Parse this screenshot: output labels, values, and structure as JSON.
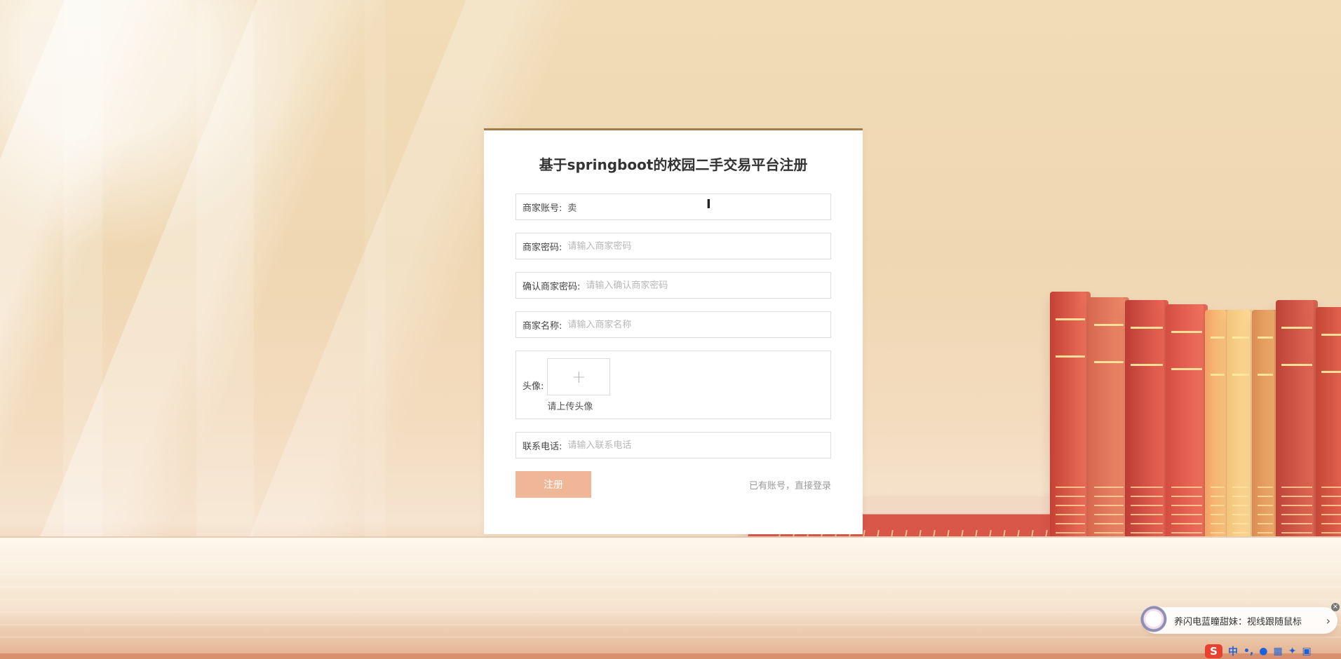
{
  "app": {
    "title": "基于springboot的校园二手交易平台注册"
  },
  "form": {
    "account_label": "商家账号:",
    "account_value": "卖",
    "account_placeholder": "",
    "password_label": "商家密码:",
    "password_placeholder": "请输入商家密码",
    "confirm_password_label": "确认商家密码:",
    "confirm_password_placeholder": "请输入确认商家密码",
    "merchant_name_label": "商家名称:",
    "merchant_name_placeholder": "请输入商家名称",
    "avatar_label": "头像:",
    "upload_icon": "+",
    "upload_hint": "请上传头像",
    "phone_label": "联系电话:",
    "phone_placeholder": "请输入联系电话",
    "register_button": "注册",
    "login_link": "已有账号，直接登录"
  },
  "popup": {
    "text": "养闪电蓝瞳甜妹：视线跟随鼠标",
    "arrow": "›",
    "close": "×"
  },
  "taskbar": {
    "sogou_icon": "S",
    "chinese_mode": "中",
    "symbol_mode": "•,",
    "mic_icon": "mic-icon",
    "keyboard_icon": "keyboard-icon",
    "skin_icon": "skin-icon",
    "grid_icon": "grid-icon"
  },
  "colors": {
    "accent": "#efb797",
    "card_border": "#a07d4b",
    "input_border": "#dddddd"
  }
}
